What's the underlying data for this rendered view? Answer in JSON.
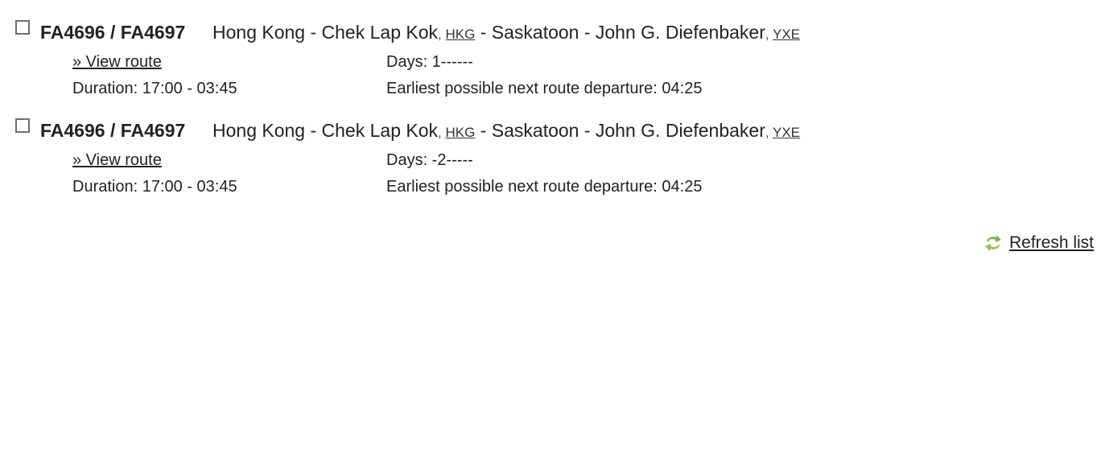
{
  "routes": [
    {
      "flight_numbers": "FA4696 / FA4697",
      "origin": "Hong Kong - Chek Lap Kok",
      "origin_code": "HKG",
      "separator": " - ",
      "destination": "Saskatoon - John G. Diefenbaker",
      "destination_code": "YXE",
      "code_sep": ", ",
      "view_route_label": "» View route",
      "days": "Days: 1------",
      "duration": "Duration: 17:00 - 03:45",
      "earliest_next": "Earliest possible next route departure: 04:25",
      "checked": false
    },
    {
      "flight_numbers": "FA4696 / FA4697",
      "origin": "Hong Kong - Chek Lap Kok",
      "origin_code": "HKG",
      "separator": " - ",
      "destination": "Saskatoon - John G. Diefenbaker",
      "destination_code": "YXE",
      "code_sep": ", ",
      "view_route_label": "» View route",
      "days": "Days: -2-----",
      "duration": "Duration: 17:00 - 03:45",
      "earliest_next": "Earliest possible next route departure: 04:25",
      "checked": false
    }
  ],
  "refresh": {
    "label": "Refresh list",
    "icon": "refresh-icon",
    "icon_color": "#7cb342"
  }
}
